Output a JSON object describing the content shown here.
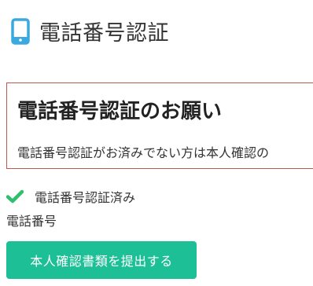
{
  "header": {
    "icon": "mobile-phone-icon",
    "title": "電話番号認証"
  },
  "notice": {
    "title": "電話番号認証のお願い",
    "body": "電話番号認証がお済みでない方は本人確認の"
  },
  "status": {
    "icon": "check-icon",
    "verified_text": "電話番号認証済み"
  },
  "phone_label": "電話番号",
  "submit_button": {
    "label": "本人確認書類を提出する"
  },
  "colors": {
    "accent": "#1dbf96",
    "phone_icon": "#3aa9e0",
    "check": "#2fbf71",
    "notice_border": "#c0574a"
  }
}
